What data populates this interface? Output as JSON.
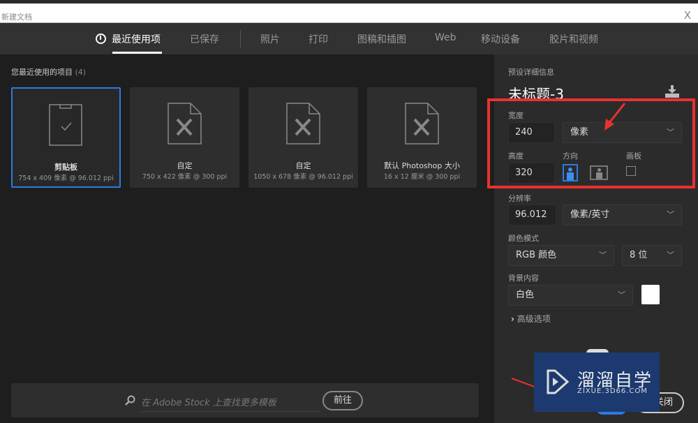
{
  "window": {
    "title": "新建文档",
    "close": "X"
  },
  "tabs": [
    {
      "label": "最近使用项",
      "active": true
    },
    {
      "label": "已保存"
    },
    {
      "label": "照片"
    },
    {
      "label": "打印"
    },
    {
      "label": "图稿和插图"
    },
    {
      "label": "Web"
    },
    {
      "label": "移动设备"
    },
    {
      "label": "胶片和视频"
    }
  ],
  "recent": {
    "label": "您最近使用的项目",
    "count": "(4)",
    "items": [
      {
        "name": "剪贴板",
        "desc": "754 x 409 像素 @ 96.012 ppi",
        "icon": "clipboard-icon",
        "selected": true
      },
      {
        "name": "自定",
        "desc": "750 x 422 像素 @ 300 ppi",
        "icon": "document-tools-icon"
      },
      {
        "name": "自定",
        "desc": "1050 x 678 像素 @ 96.012 ppi",
        "icon": "document-tools-icon"
      },
      {
        "name": "默认 Photoshop 大小",
        "desc": "16 x 12 厘米 @ 300 ppi",
        "icon": "document-tools-icon"
      }
    ]
  },
  "search": {
    "placeholder": "在 Adobe Stock 上查找更多模板",
    "go": "前往"
  },
  "preset": {
    "header": "预设详细信息",
    "name": "未标题-3",
    "width_label": "宽度",
    "width": "240",
    "width_unit": "像素",
    "height_label": "高度",
    "height": "320",
    "orientation_label": "方向",
    "orientation": "portrait",
    "artboard_label": "画板",
    "artboard": false,
    "resolution_label": "分辨率",
    "resolution": "96.012",
    "resolution_unit": "像素/英寸",
    "color_mode_label": "颜色模式",
    "color_mode": "RGB 颜色",
    "bit_depth": "8 位",
    "background_label": "背景内容",
    "background": "白色",
    "background_color": "#ffffff",
    "advanced": "高级选项",
    "close": "关闭"
  },
  "watermark": {
    "title": "溜溜自学",
    "url": "ZIXUE.3D66.COM"
  },
  "colors": {
    "accent": "#2d7ae0",
    "annotation": "#e8322e"
  }
}
